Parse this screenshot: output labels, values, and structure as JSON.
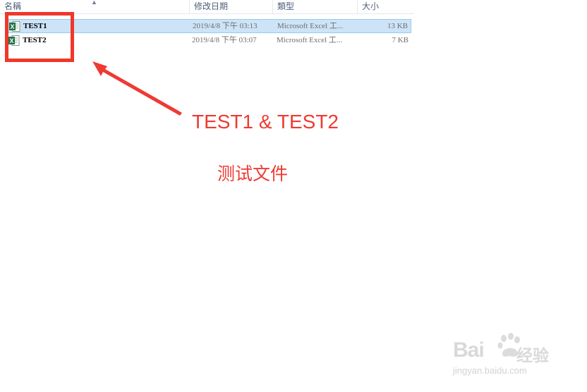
{
  "columns": {
    "name": "名稱",
    "date": "修改日期",
    "type": "類型",
    "size": "大小"
  },
  "files": [
    {
      "name": "TEST1",
      "date": "2019/4/8 下午 03:13",
      "type": "Microsoft Excel 工...",
      "size": "13 KB",
      "icon": "excel-file-icon",
      "selected": true
    },
    {
      "name": "TEST2",
      "date": "2019/4/8 下午 03:07",
      "type": "Microsoft Excel 工...",
      "size": "7 KB",
      "icon": "excel-file-icon",
      "selected": false
    }
  ],
  "annotation": {
    "title": "TEST1 & TEST2",
    "subtitle": "测试文件",
    "color": "#ee3a33"
  },
  "watermark": {
    "brand": "Bai",
    "brand_suffix": "经验",
    "url": "jingyan.baidu.com"
  },
  "colors": {
    "selection_bg": "#cce4f7",
    "selection_border": "#99c9ef",
    "excel_green": "#1e7145"
  }
}
